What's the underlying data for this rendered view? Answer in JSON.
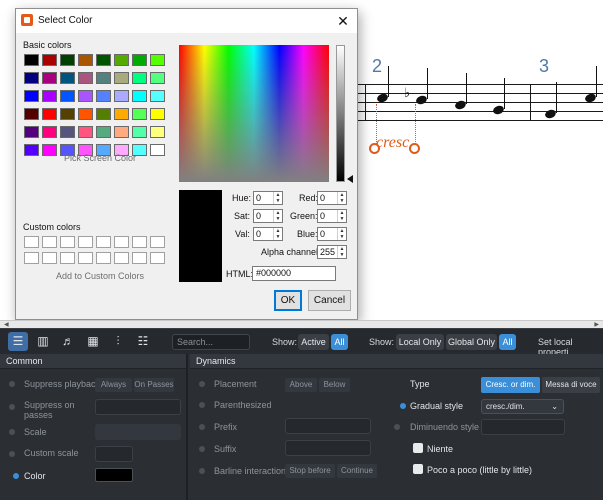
{
  "score": {
    "measure_numbers": [
      "2",
      "3"
    ],
    "dynamic_text": "cresc."
  },
  "dialog": {
    "title": "Select Color",
    "close_glyph": "✕",
    "basic_colors_label": "Basic colors",
    "pick_screen_label": "Pick Screen Color",
    "custom_colors_label": "Custom colors",
    "add_custom_label": "Add to Custom Colors",
    "basic_colors": [
      "#000000",
      "#aa0000",
      "#004000",
      "#aa5500",
      "#005500",
      "#55aa00",
      "#00aa00",
      "#55ff00",
      "#000080",
      "#aa007f",
      "#005580",
      "#aa557f",
      "#558080",
      "#aaaa7f",
      "#00ff80",
      "#55ff7f",
      "#0000ff",
      "#aa00ff",
      "#0055ff",
      "#aa55ff",
      "#5580ff",
      "#aaaaff",
      "#00ffff",
      "#55ffff",
      "#550000",
      "#ff0000",
      "#554000",
      "#ff5500",
      "#557f00",
      "#ffaa00",
      "#55ff55",
      "#ffff00",
      "#55007f",
      "#ff007f",
      "#55557f",
      "#ff557f",
      "#55aa7f",
      "#ffaa7f",
      "#55ffaa",
      "#ffff7f",
      "#5500ff",
      "#ff00ff",
      "#5555ff",
      "#ff55ff",
      "#55aaff",
      "#ffaaff",
      "#55ffff",
      "#ffffff"
    ],
    "fields": {
      "hue_label": "Hue:",
      "hue": "0",
      "sat_label": "Sat:",
      "sat": "0",
      "val_label": "Val:",
      "val": "0",
      "red_label": "Red:",
      "red": "0",
      "green_label": "Green:",
      "green": "0",
      "blue_label": "Blue:",
      "blue": "0",
      "alpha_label": "Alpha channel:",
      "alpha": "255",
      "html_label": "HTML:",
      "html": "#000000"
    },
    "ok_label": "OK",
    "cancel_label": "Cancel"
  },
  "toolbar": {
    "search_placeholder": "Search...",
    "show_label_1": "Show:",
    "active_label": "Active",
    "all_label_1": "All",
    "show_label_2": "Show:",
    "local_only_label": "Local Only",
    "global_only_label": "Global Only",
    "all_label_2": "All",
    "set_local_label": "Set local properti"
  },
  "common": {
    "title": "Common",
    "suppress_playback": "Suppress playback",
    "always": "Always",
    "on_passes": "On Passes",
    "suppress_on_passes": "Suppress on passes",
    "scale": "Scale",
    "custom_scale": "Custom scale",
    "color": "Color",
    "color_value": "#000000"
  },
  "dynamics": {
    "title": "Dynamics",
    "placement": "Placement",
    "above": "Above",
    "below": "Below",
    "parenthesized": "Parenthesized",
    "prefix": "Prefix",
    "suffix": "Suffix",
    "barline_interaction": "Barline interaction",
    "stop_before": "Stop before",
    "continue": "Continue",
    "type_label": "Type",
    "type_cresc": "Cresc. or dim.",
    "type_messa": "Messa di voce",
    "gradual_style": "Gradual style",
    "gradual_value": "cresc./dim.",
    "diminuendo_style": "Diminuendo style",
    "niente": "Niente",
    "poco_a_poco": "Poco a poco (little by little)"
  },
  "colors": {
    "accent": "#3b8fd9",
    "dynamic_orange": "#e35b18",
    "measure_blue": "#4f79ac"
  }
}
